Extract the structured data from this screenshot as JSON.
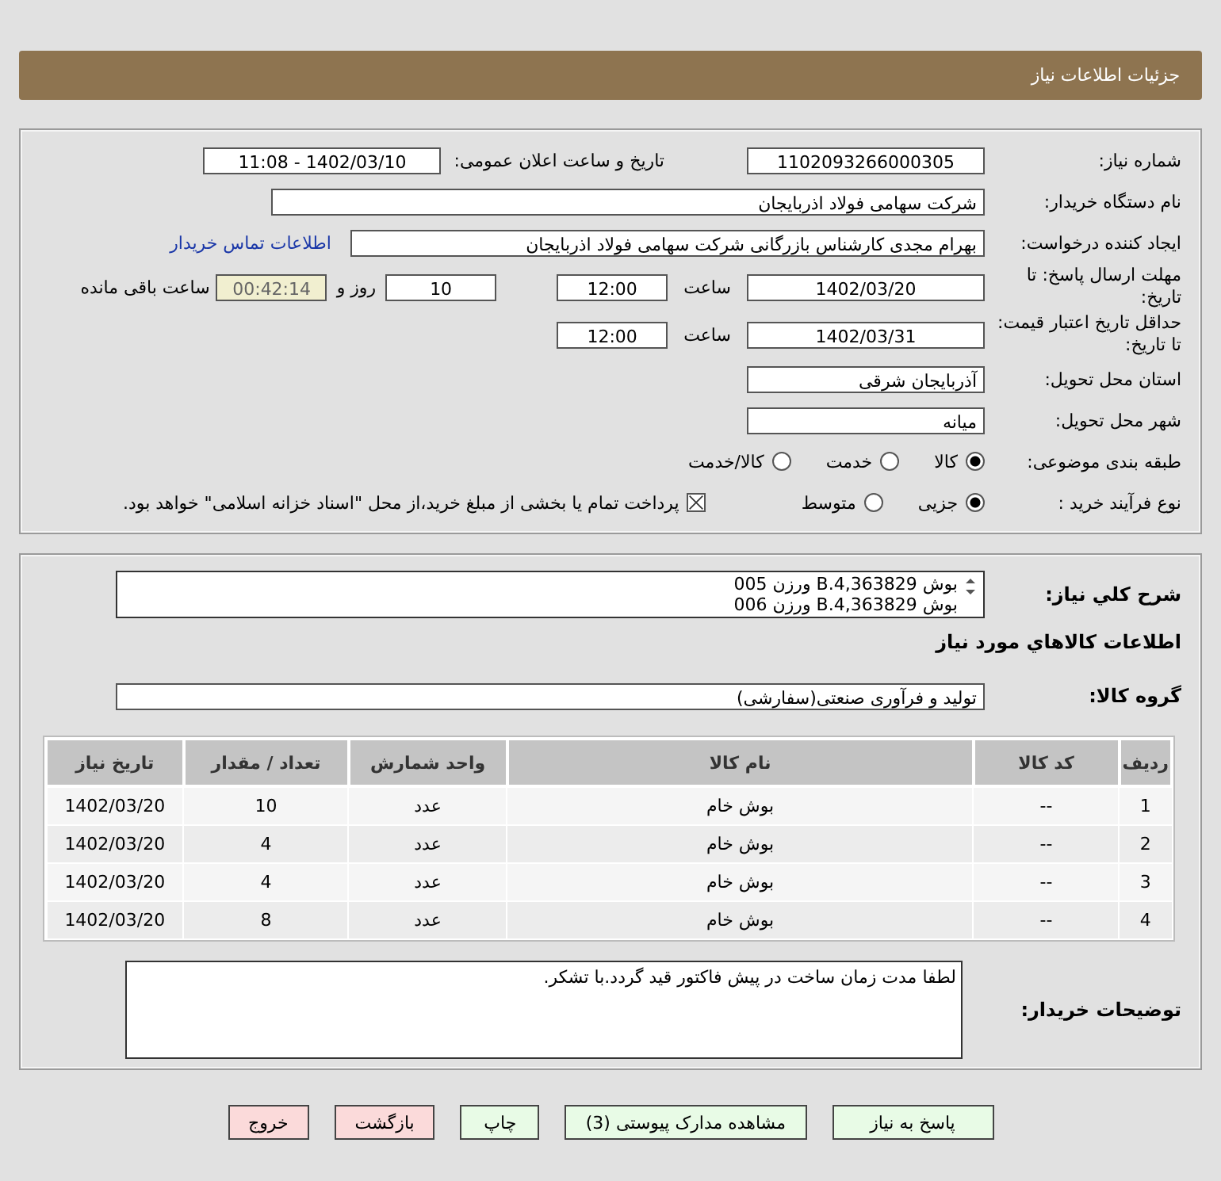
{
  "header": {
    "title": "جزئیات اطلاعات نیاز"
  },
  "details": {
    "need_number": {
      "label": "شماره نیاز:",
      "value": "1102093266000305"
    },
    "announce": {
      "label": "تاریخ و ساعت اعلان عمومی:",
      "value": "1402/03/10 - 11:08"
    },
    "buyer": {
      "label": "نام دستگاه خریدار:",
      "value": "شرکت سهامی فولاد اذربایجان"
    },
    "requester": {
      "label": "ایجاد کننده درخواست:",
      "value": "بهرام مجدی کارشناس بازرگانی شرکت سهامی فولاد اذربایجان",
      "link": "اطلاعات تماس خریدار"
    },
    "deadline": {
      "label": "مهلت ارسال پاسخ: تا تاریخ:",
      "date": "1402/03/20",
      "time_label": "ساعت",
      "time": "12:00",
      "days": "10",
      "days_label": "روز و",
      "remaining": "00:42:14",
      "remaining_label": "ساعت باقی مانده"
    },
    "validity": {
      "label": "حداقل تاریخ اعتبار قیمت: تا تاریخ:",
      "date": "1402/03/31",
      "time_label": "ساعت",
      "time": "12:00"
    },
    "province": {
      "label": "استان محل تحویل:",
      "value": "آذربایجان شرقی"
    },
    "city": {
      "label": "شهر محل تحویل:",
      "value": "میانه"
    },
    "category": {
      "label": "طبقه بندی موضوعی:",
      "options": [
        {
          "label": "کالا",
          "selected": true
        },
        {
          "label": "خدمت",
          "selected": false
        },
        {
          "label": "کالا/خدمت",
          "selected": false
        }
      ]
    },
    "process": {
      "label": "نوع فرآیند خرید :",
      "options": [
        {
          "label": "جزیی",
          "selected": true
        },
        {
          "label": "متوسط",
          "selected": false
        }
      ],
      "payment": {
        "label": "پرداخت تمام یا بخشی از مبلغ خرید،از محل \"اسناد خزانه اسلامی\" خواهد بود.",
        "checked": true
      }
    }
  },
  "goods": {
    "description": {
      "label": "شرح کلي نياز:",
      "lines": [
        "بوش B.4,363829 ورزن 005",
        "بوش B.4,363829 ورزن 006"
      ]
    },
    "heading": "اطلاعات کالاهاي مورد نياز",
    "group": {
      "label": "گروه کالا:",
      "value": "تولید و فرآوری صنعتی(سفارشی)"
    },
    "table": {
      "columns": [
        "ردیف",
        "کد کالا",
        "نام کالا",
        "واحد شمارش",
        "تعداد / مقدار",
        "تاریخ نیاز"
      ],
      "rows": [
        [
          "1",
          "--",
          "بوش خام",
          "عدد",
          "10",
          "1402/03/20"
        ],
        [
          "2",
          "--",
          "بوش خام",
          "عدد",
          "4",
          "1402/03/20"
        ],
        [
          "3",
          "--",
          "بوش خام",
          "عدد",
          "4",
          "1402/03/20"
        ],
        [
          "4",
          "--",
          "بوش خام",
          "عدد",
          "8",
          "1402/03/20"
        ]
      ]
    },
    "notes": {
      "label": "توضیحات خریدار:",
      "value": "لطفا مدت زمان ساخت در پیش فاکتور قید گردد.با تشکر."
    }
  },
  "buttons": [
    {
      "label": "پاسخ به نیاز",
      "kind": "primary"
    },
    {
      "label": "مشاهده مدارک پیوستی (3)",
      "kind": "primary"
    },
    {
      "label": "چاپ",
      "kind": "primary"
    },
    {
      "label": "بازگشت",
      "kind": "danger"
    },
    {
      "label": "خروج",
      "kind": "danger"
    }
  ]
}
